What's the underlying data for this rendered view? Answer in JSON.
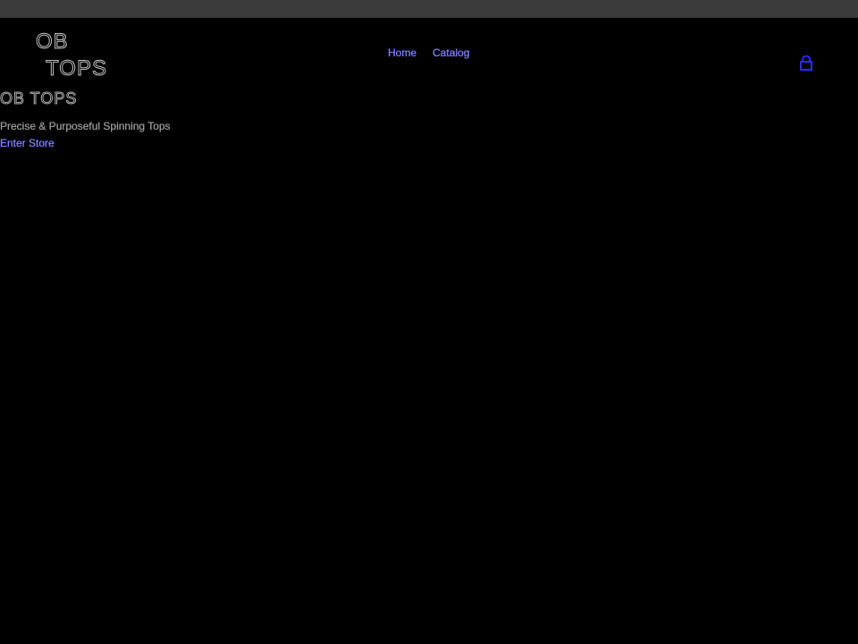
{
  "header": {
    "logo_line1": "OB",
    "logo_line2": "TOPS",
    "nav": [
      {
        "label": "Home"
      },
      {
        "label": "Catalog"
      }
    ],
    "cart_icon": "cart-icon"
  },
  "hero": {
    "title": "OB TOPS",
    "subtitle": "Precise & Purposeful Spinning Tops",
    "cta_label": "Enter Store"
  },
  "colors": {
    "background": "#000000",
    "top_strip": "#3b3b3b",
    "link": "#8a8aff",
    "cart": "#2a2aff",
    "text_muted": "#a0a0a0"
  }
}
